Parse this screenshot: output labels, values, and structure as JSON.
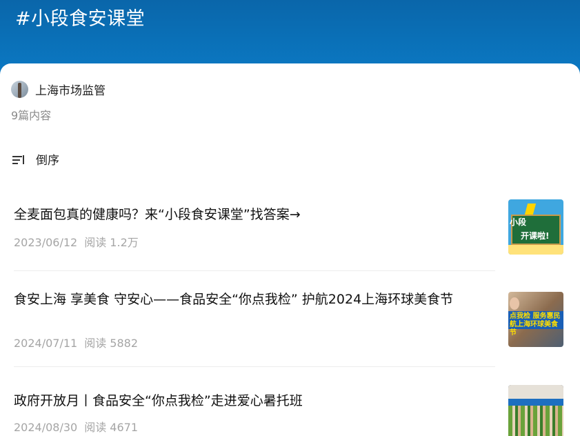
{
  "header": {
    "title": "#小段食安课堂"
  },
  "author": {
    "name": "上海市场监管"
  },
  "summary": {
    "count_text": "9篇内容"
  },
  "sort": {
    "label": "倒序"
  },
  "articles": [
    {
      "title": "全麦面包真的健康吗？来“小段食安课堂”找答案→",
      "date": "2023/06/12",
      "views": "阅读 1.2万"
    },
    {
      "title": "食安上海 享美食 守安心——食品安全“你点我检” 护航2024上海环球美食节",
      "date": "2024/07/11",
      "views": "阅读 5882"
    },
    {
      "title": "政府开放月丨食品安全“你点我检”走进爱心暑托班",
      "date": "2024/08/30",
      "views": "阅读 4671"
    }
  ],
  "thumb1": {
    "line1": "小段",
    "line2": "开课啦!"
  },
  "thumb2": {
    "text": "点我检 服务惠民 航上海环球美食节"
  },
  "colors": {
    "header_top": "#0a66aa",
    "header_bottom": "#0b7bc6",
    "meta": "#a5a5a5"
  }
}
